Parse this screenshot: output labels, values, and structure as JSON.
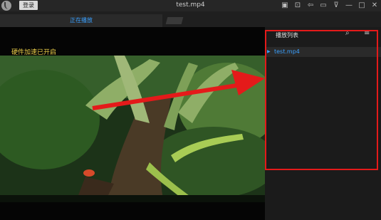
{
  "titlebar": {
    "login_label": "登录",
    "title": "test.mp4",
    "controls": [
      {
        "name": "mini-mode-icon",
        "glyph": "▣"
      },
      {
        "name": "pin-icon",
        "glyph": "⊡"
      },
      {
        "name": "share-icon",
        "glyph": "⇦"
      },
      {
        "name": "folder-icon",
        "glyph": "▭"
      },
      {
        "name": "dropdown-icon",
        "glyph": "⊽"
      },
      {
        "name": "minimize-icon",
        "glyph": "—"
      },
      {
        "name": "maximize-icon",
        "glyph": "□"
      },
      {
        "name": "close-icon",
        "glyph": "✕"
      }
    ]
  },
  "tabs": {
    "active_label": "正在播放"
  },
  "video": {
    "overlay_text": "硬件加速已开启"
  },
  "playlist": {
    "title": "播放列表",
    "search_icon": "⌕",
    "menu_icon": "≡",
    "items": [
      {
        "play_marker": "▶",
        "filename": "test.mp4"
      }
    ]
  },
  "colors": {
    "accent": "#3aa0ff",
    "highlight_box": "#e41a1a",
    "overlay_text": "#f0d24a"
  }
}
